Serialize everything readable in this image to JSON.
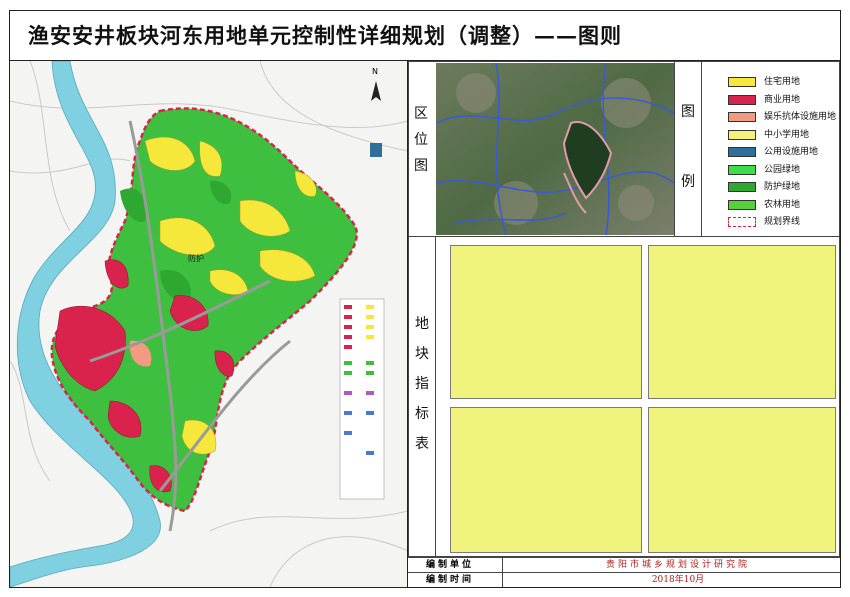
{
  "title": "渔安安井板块河东用地单元控制性详细规划（调整）——图则",
  "map": {
    "north_label": "N",
    "district_label": "防护"
  },
  "location_section": {
    "label_chars": [
      "区",
      "位",
      "图"
    ]
  },
  "legend_section": {
    "label_chars": [
      "图",
      "例"
    ],
    "items": [
      {
        "label": "住宅用地",
        "color": "#f5e83a"
      },
      {
        "label": "商业用地",
        "color": "#d9234c"
      },
      {
        "label": "娱乐抗体设施用地",
        "color": "#f29a82"
      },
      {
        "label": "中小学用地",
        "color": "#f4f07a"
      },
      {
        "label": "公用设施用地",
        "color": "#2f6f9a"
      },
      {
        "label": "公园绿地",
        "color": "#3ddc4a"
      },
      {
        "label": "防护绿地",
        "color": "#2fa832"
      },
      {
        "label": "农林用地",
        "color": "#59cf3c"
      },
      {
        "label": "规划界线",
        "color": "#d9234c"
      }
    ]
  },
  "indicator_section": {
    "label_chars": [
      "地",
      "块",
      "指",
      "标",
      "表"
    ]
  },
  "footer": {
    "unit_label": "编制单位",
    "unit_value": "贵阳市城乡规划设计研究院",
    "time_label": "编制时间",
    "time_value": "2018年10月"
  },
  "colors": {
    "residential": "#f5e83a",
    "commercial": "#d9234c",
    "green": "#3fbf3f",
    "river": "#7fd0e0",
    "table_fill": "#f0f47c"
  }
}
